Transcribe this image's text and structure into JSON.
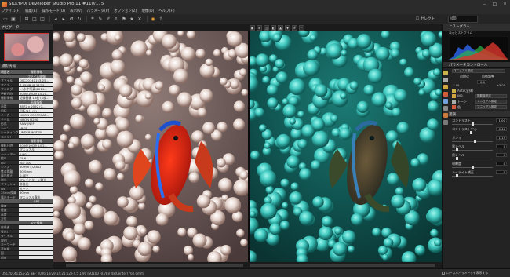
{
  "window": {
    "title": "SILKYPIX Developer Studio Pro 11    #110/175",
    "controls": [
      "–",
      "□",
      "×"
    ]
  },
  "menu": [
    "ファイル(F)",
    "編集(E)",
    "操作モード(O)",
    "表示(V)",
    "パラメータ(P)",
    "オプション(Z)",
    "現像(D)",
    "ヘルプ(H)"
  ],
  "toolbar": {
    "icons": [
      "folder-icon",
      "save-icon",
      "grid-icon",
      "single-view-icon",
      "compare-icon",
      "arrow-left-icon",
      "arrow-right-icon",
      "rotate-ccw-icon",
      "rotate-cw-icon",
      "crop-icon",
      "tools-icon",
      "eyedropper-icon",
      "loupe-icon",
      "flag-icon",
      "star-icon",
      "trash-icon",
      "develop-icon",
      "export-icon"
    ],
    "select_label": "セレクト",
    "search_placeholder": "撮影"
  },
  "navigator": {
    "title": "ナビゲーター"
  },
  "exif": {
    "title": "撮影情報",
    "rows": [
      {
        "k": "項目名",
        "v": "撮影情報",
        "sec": true
      },
      {
        "k": "",
        "v": "ファイル情報",
        "sec": true
      },
      {
        "k": "ファイル",
        "v": "DSC20141153-25..."
      },
      {
        "k": "サイズ",
        "v": "7.95MB (8,337,5..."
      },
      {
        "k": "フォルダ",
        "v": "...\\水中写真\\2014..."
      },
      {
        "k": "更新日時",
        "v": "2006/10/29 14:21..."
      },
      {
        "k": "撮影情報",
        "v": "記録画像 13枚 (1枚..."
      },
      {
        "k": "",
        "v": "画像情報",
        "sec": true
      },
      {
        "k": "画素",
        "v": "3872 x 2592 (7..."
      },
      {
        "k": "回転",
        "v": "回転なし (1)"
      },
      {
        "k": "メーカー",
        "v": "NIKON CORPORAT..."
      },
      {
        "k": "モデル",
        "v": "NIKON D200"
      },
      {
        "k": "形式",
        "v": "RAW (NEF)"
      },
      {
        "k": "シーン",
        "v": "sRGB"
      },
      {
        "k": "レーティング",
        "v": "UNDER WATER"
      },
      {
        "k": "コメント",
        "v": ""
      },
      {
        "k": "",
        "v": "撮影情報",
        "sec": true
      },
      {
        "k": "撮影日時",
        "v": "2006/10/29 14:2..."
      },
      {
        "k": "露出",
        "v": "マニュアル"
      },
      {
        "k": "シャッター",
        "v": "1/90"
      },
      {
        "k": "絞り",
        "v": "F5.6"
      },
      {
        "k": "ISO",
        "v": "ISO 100"
      },
      {
        "k": "レンズ",
        "v": "60mm F/2.8 D"
      },
      {
        "k": "焦点距離",
        "v": "60.0mm"
      },
      {
        "k": "露出補正",
        "v": "0.0EV"
      },
      {
        "k": "測光",
        "v": "マルチパターン測光"
      },
      {
        "k": "フラッシュ",
        "v": "非発光"
      },
      {
        "k": "WB",
        "v": "オート"
      },
      {
        "k": "35mm換算",
        "v": "90mm"
      },
      {
        "k": "露出モード",
        "v": "マニュアル露出"
      },
      {
        "k": "",
        "v": "GPS",
        "sec": true
      },
      {
        "k": "緯度",
        "v": ""
      },
      {
        "k": "経度",
        "v": ""
      },
      {
        "k": "高度",
        "v": ""
      },
      {
        "k": "方位",
        "v": ""
      },
      {
        "k": "",
        "v": "IPTC情報",
        "sec": true
      },
      {
        "k": "作成者",
        "v": ""
      },
      {
        "k": "見出し",
        "v": ""
      },
      {
        "k": "タイトル",
        "v": ""
      },
      {
        "k": "説明",
        "v": ""
      },
      {
        "k": "キーワード",
        "v": ""
      },
      {
        "k": "著作権",
        "v": ""
      },
      {
        "k": "国",
        "v": ""
      },
      {
        "k": "都市",
        "v": ""
      }
    ]
  },
  "histogram": {
    "title": "ヒストグラム",
    "subtitle": "表示ヒストグラム"
  },
  "controls": {
    "title": "パラメータコントロール",
    "preset_label": "マニュアル設定",
    "tabs": [
      "初期化",
      "自動調整"
    ],
    "exposure_value": "0.0",
    "exposure_scale": [
      "-3.00",
      "+3.00"
    ],
    "items": [
      {
        "label": "Auto(全体)",
        "value": "",
        "color": "#c9b24a"
      },
      {
        "label": "WB",
        "value": "撮影時設定",
        "color": "#d6a640"
      },
      {
        "label": "トーン",
        "value": "マニュアル設定",
        "color": "#aaa"
      },
      {
        "label": "色",
        "value": "マニュアル設定",
        "color": "#d35b3a"
      }
    ],
    "tone_section": "諧調",
    "sliders": [
      {
        "label": "コントラスト",
        "value": "1.00",
        "pos": 0.5
      },
      {
        "label": "コントラスト中心",
        "value": "0.46",
        "pos": 0.46
      },
      {
        "label": "ガンマ",
        "value": "1.15",
        "pos": 0.55
      },
      {
        "label": "黒レベル",
        "value": "0",
        "pos": 0.1
      },
      {
        "label": "黒レベル",
        "value": "0",
        "pos": 0.1
      },
      {
        "label": "明瞭度",
        "value": "0",
        "pos": 0.5
      },
      {
        "label": "ハイライト補正",
        "value": "0",
        "pos": 0.1
      }
    ]
  },
  "status": {
    "text": "DSC20141153-25.NEF 2006/10/29 14:21:52 F4.5 1/90 ISO100 -0.7EV 4x(Center)  \"60.0mm",
    "checkbox_label": "ローカルパラメータを表示する"
  }
}
